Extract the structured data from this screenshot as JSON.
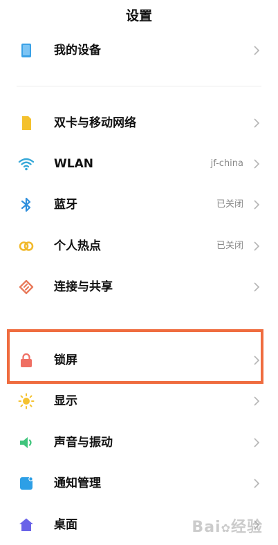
{
  "header": {
    "title": "设置"
  },
  "colors": {
    "highlight": "#ef6c3f",
    "chevron": "#b5b5b5",
    "value": "#888888"
  },
  "sections": {
    "device": [
      {
        "label": "我的设备",
        "value": "",
        "icon": "phone-device-icon"
      }
    ],
    "network": [
      {
        "label": "双卡与移动网络",
        "value": "",
        "icon": "sim-card-icon"
      },
      {
        "label": "WLAN",
        "value": "jf-china",
        "icon": "wifi-icon"
      },
      {
        "label": "蓝牙",
        "value": "已关闭",
        "icon": "bluetooth-icon"
      },
      {
        "label": "个人热点",
        "value": "已关闭",
        "icon": "hotspot-icon"
      },
      {
        "label": "连接与共享",
        "value": "",
        "icon": "connection-share-icon"
      }
    ],
    "system": [
      {
        "label": "锁屏",
        "value": "",
        "icon": "lock-icon"
      },
      {
        "label": "显示",
        "value": "",
        "icon": "sun-icon"
      },
      {
        "label": "声音与振动",
        "value": "",
        "icon": "speaker-icon"
      },
      {
        "label": "通知管理",
        "value": "",
        "icon": "notification-icon"
      },
      {
        "label": "桌面",
        "value": "",
        "icon": "home-icon"
      }
    ]
  },
  "watermark": {
    "text": "Bai",
    "text2": "经验"
  }
}
